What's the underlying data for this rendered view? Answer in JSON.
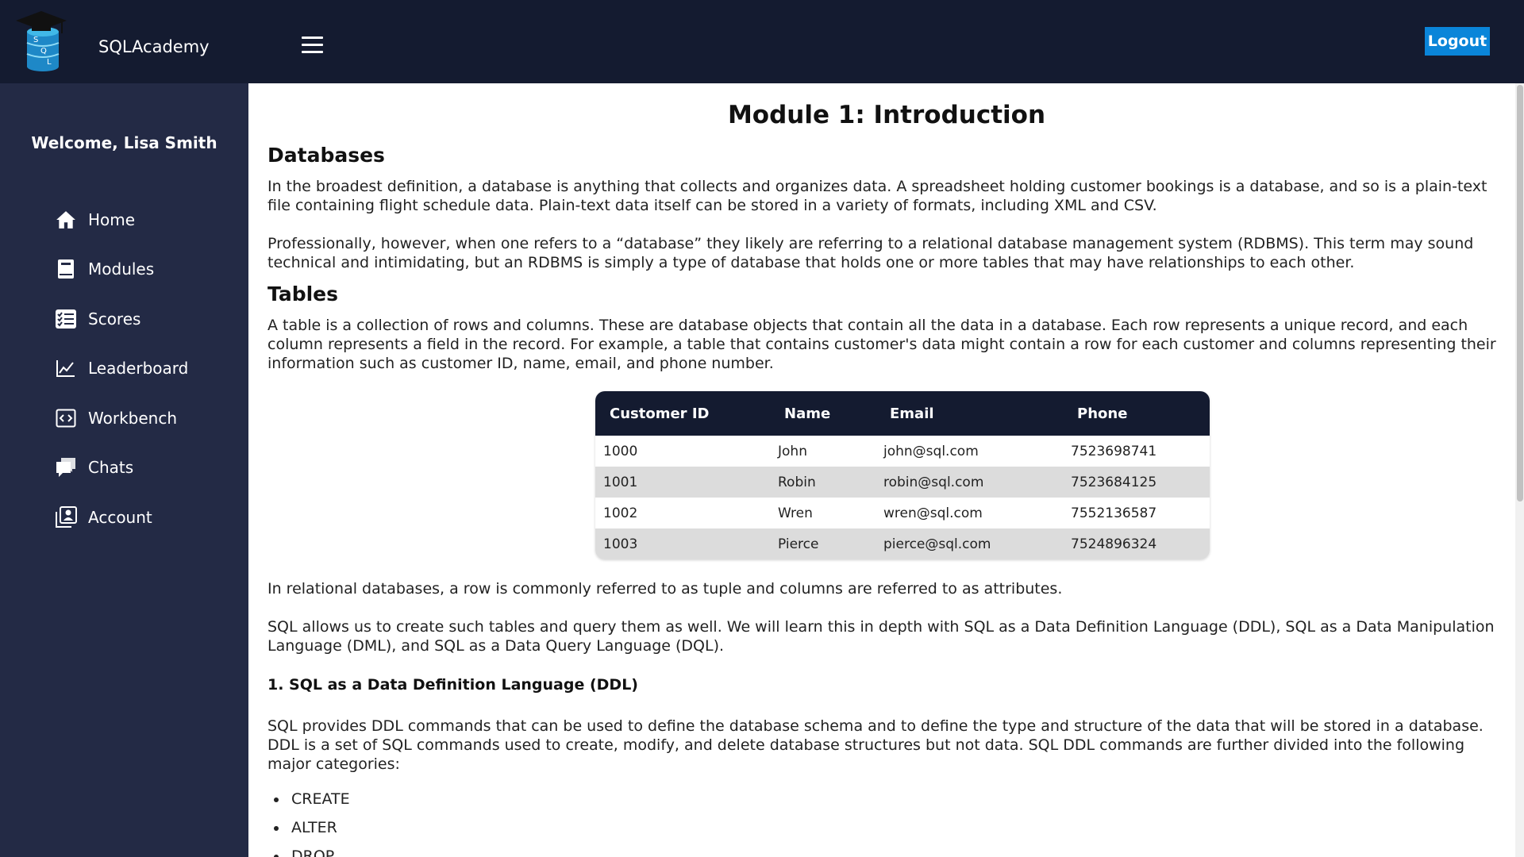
{
  "header": {
    "brand": "SQLAcademy",
    "logo_letters": [
      "S",
      "Q",
      "L"
    ],
    "logout_label": "Logout",
    "colors": {
      "bar": "#141b30",
      "logout": "#0a85d9"
    }
  },
  "sidebar": {
    "welcome": "Welcome, Lisa Smith",
    "items": [
      {
        "label": "Home",
        "icon": "home-icon"
      },
      {
        "label": "Modules",
        "icon": "book-icon"
      },
      {
        "label": "Scores",
        "icon": "checklist-icon"
      },
      {
        "label": "Leaderboard",
        "icon": "line-chart-icon"
      },
      {
        "label": "Workbench",
        "icon": "code-icon"
      },
      {
        "label": "Chats",
        "icon": "chat-icon"
      },
      {
        "label": "Account",
        "icon": "account-icon"
      }
    ]
  },
  "main": {
    "title": "Module 1: Introduction",
    "databases_heading": "Databases",
    "databases_p1": "In the broadest definition, a database is anything that collects and organizes data. A spreadsheet holding customer bookings is a database, and so is a plain-text file containing flight schedule data. Plain-text data itself can be stored in a variety of formats, including XML and CSV.",
    "databases_p2": "Professionally, however, when one refers to a “database” they likely are referring to a relational database management system (RDBMS). This term may sound technical and intimidating, but an RDBMS is simply a type of database that holds one or more tables that may have relationships to each other.",
    "tables_heading": "Tables",
    "tables_p1": "A table is a collection of rows and columns. These are database objects that contain all the data in a database. Each row represents a unique record, and each column represents a field in the record. For example, a table that contains customer's data might contain a row for each customer and columns representing their information such as customer ID, name, email, and phone number.",
    "table": {
      "headers": [
        "Customer ID",
        "Name",
        "Email",
        "Phone"
      ],
      "rows": [
        [
          "1000",
          "John",
          "john@sql.com",
          "7523698741"
        ],
        [
          "1001",
          "Robin",
          "robin@sql.com",
          "7523684125"
        ],
        [
          "1002",
          "Wren",
          "wren@sql.com",
          "7552136587"
        ],
        [
          "1003",
          "Pierce",
          "pierce@sql.com",
          "7524896324"
        ]
      ]
    },
    "relational_p": "In relational databases, a row is commonly referred to as tuple and columns are referred to as attributes.",
    "sql_p": "SQL allows us to create such tables and query them as well. We will learn this in depth with SQL as a Data Definition Language (DDL), SQL as a Data Manipulation Language (DML), and SQL as a Data Query Language (DQL).",
    "ddl_heading": "1.   SQL as a Data Definition Language (DDL)",
    "ddl_p": "SQL provides DDL commands that can be used to define the database schema and to define the type and structure of the data that will be stored in a database. DDL is a set of SQL commands used to create, modify, and delete database structures but not data. SQL DDL commands are further divided into the following major categories:",
    "ddl_commands": [
      "CREATE",
      "ALTER",
      "DROP"
    ]
  }
}
